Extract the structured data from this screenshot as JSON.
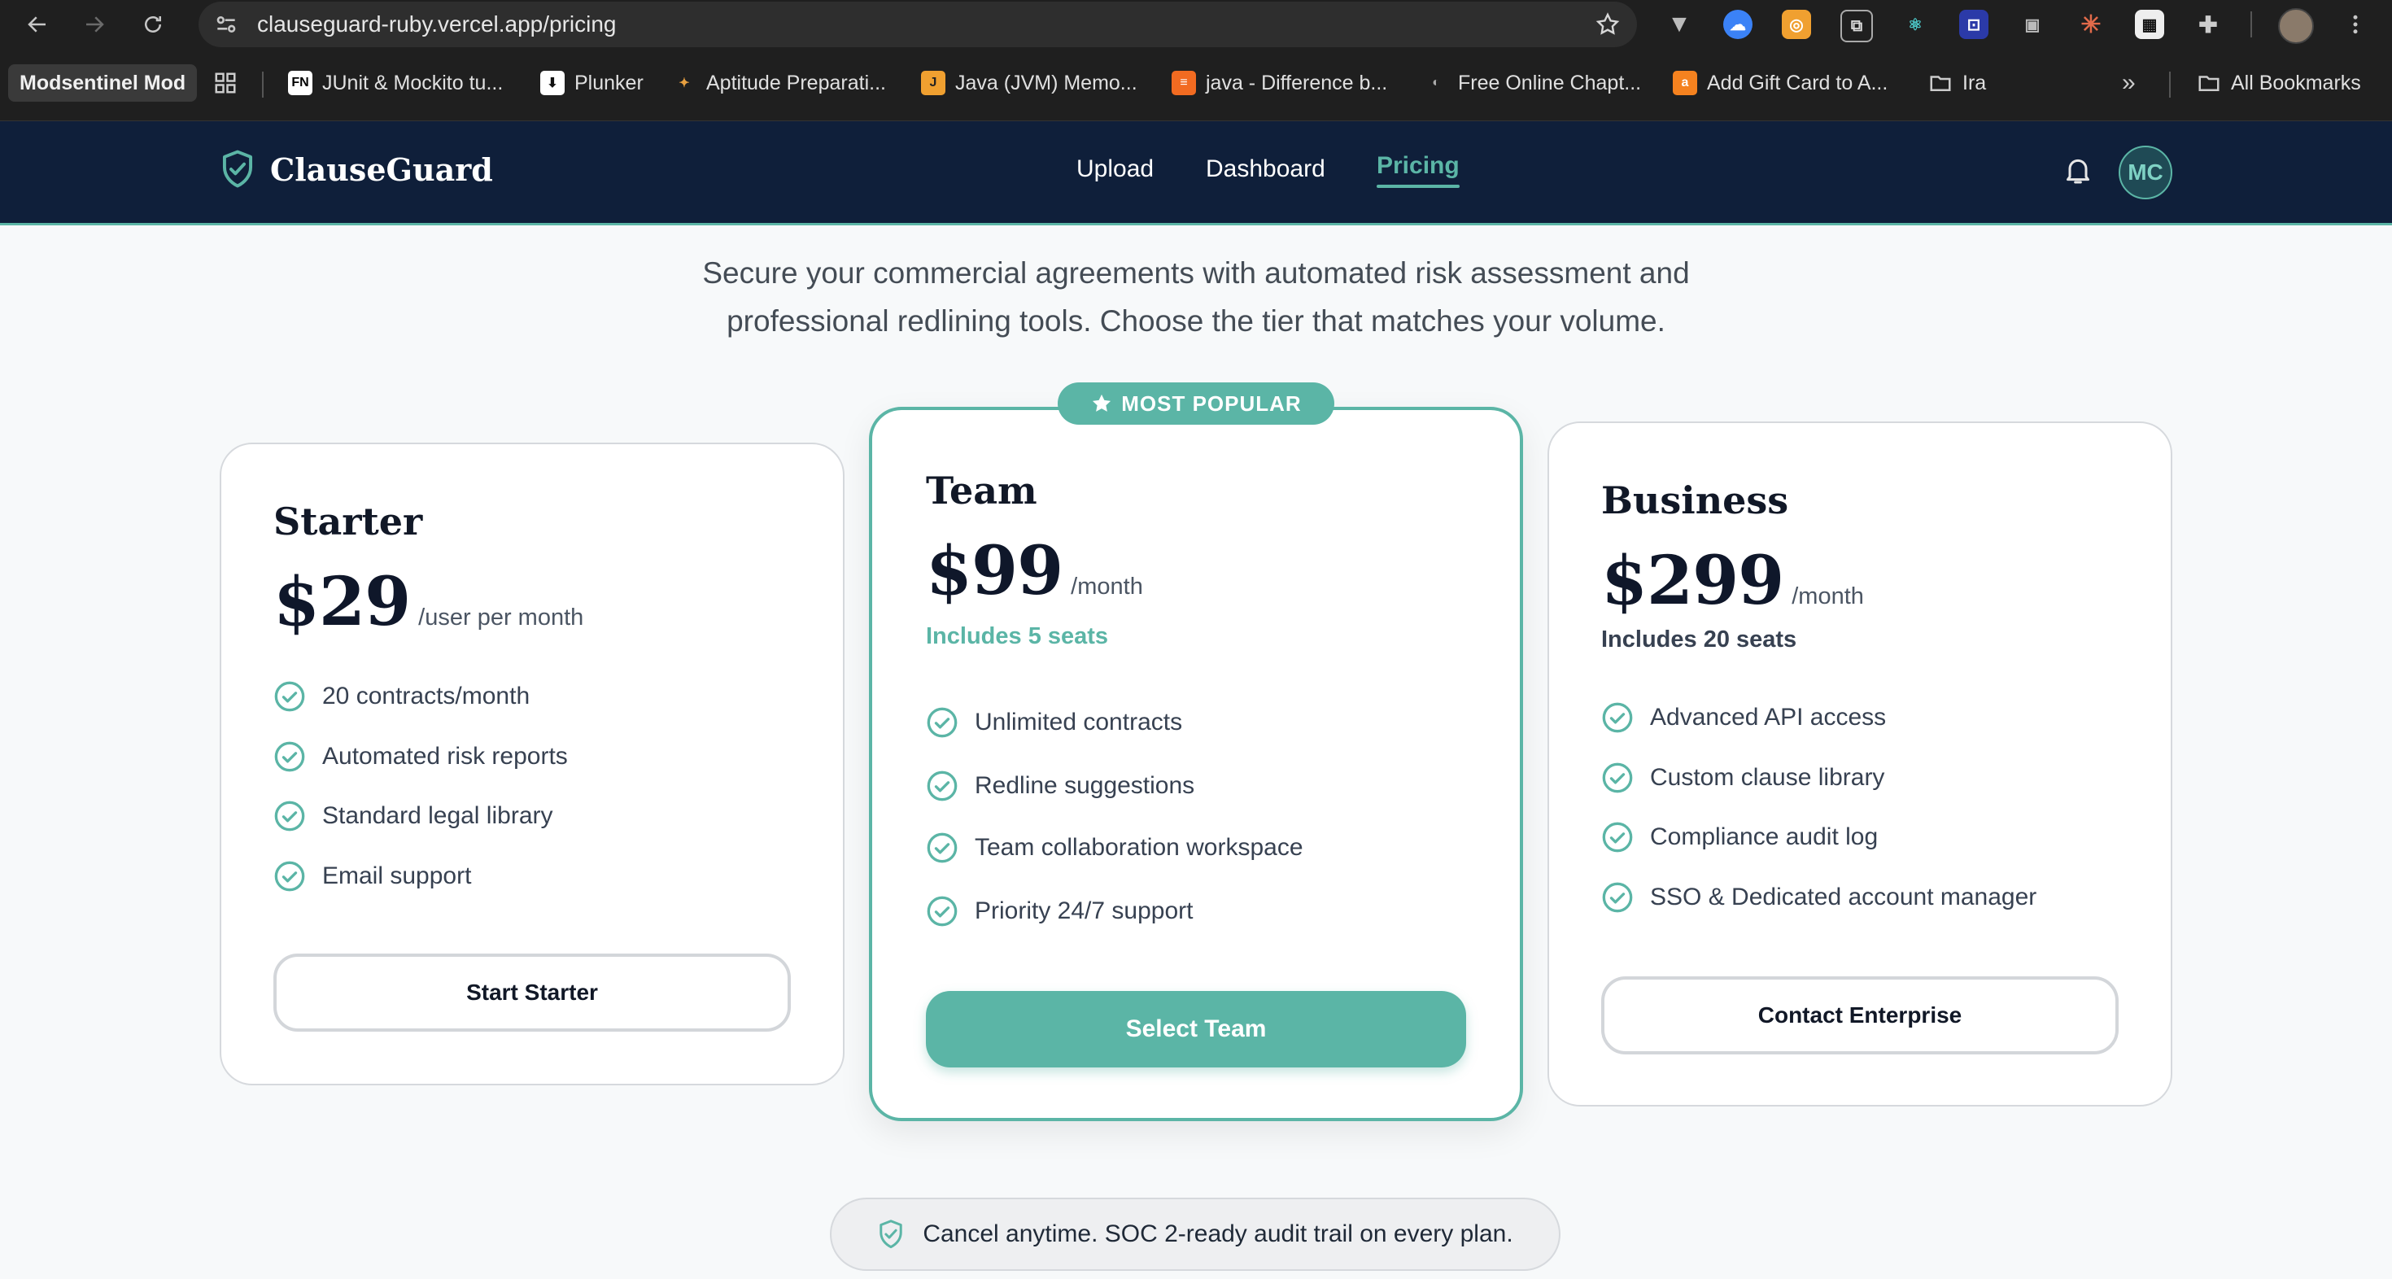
{
  "browser": {
    "url": "clauseguard-ruby.vercel.app/pricing",
    "bookmarks": [
      {
        "label": "Modsentinel Mod",
        "icon": "none"
      },
      {
        "label": "",
        "icon": "apps-grid-icon"
      },
      {
        "label": "JUnit & Mockito tu...",
        "icon": "fn-favicon",
        "fav_text": "FN",
        "fav_color": "#ffffff"
      },
      {
        "label": "Plunker",
        "icon": "plunker-favicon"
      },
      {
        "label": "Aptitude Preparati...",
        "icon": "aptitude-favicon"
      },
      {
        "label": "Java (JVM) Memo...",
        "icon": "java-favicon",
        "fav_text": "J",
        "fav_color": "#f0a030"
      },
      {
        "label": "java - Difference b...",
        "icon": "stackoverflow-favicon"
      },
      {
        "label": "Free Online Chapt...",
        "icon": "chapter-favicon"
      },
      {
        "label": "Add Gift Card to A...",
        "icon": "amazon-favicon",
        "fav_text": "a",
        "fav_color": "#f5821f"
      },
      {
        "label": "Ira",
        "icon": "folder-icon"
      }
    ],
    "all_bookmarks": "All Bookmarks"
  },
  "app": {
    "brand": "ClauseGuard",
    "nav": {
      "upload": "Upload",
      "dashboard": "Dashboard",
      "pricing": "Pricing"
    },
    "avatar_initials": "MC",
    "accent_color": "#5bb5a6",
    "header_color": "#0f1f3a"
  },
  "pricing": {
    "subtitle_line1": "Secure your commercial agreements with automated risk assessment and",
    "subtitle_line2": "professional redlining tools. Choose the tier that matches your volume.",
    "badge": "MOST POPULAR",
    "plans": [
      {
        "name": "Starter",
        "price": "$29",
        "period": "/user per month",
        "seats": "",
        "features": [
          "20 contracts/month",
          "Automated risk reports",
          "Standard legal library",
          "Email support"
        ],
        "cta": "Start Starter"
      },
      {
        "name": "Team",
        "price": "$99",
        "period": "/month",
        "seats": "Includes 5 seats",
        "features": [
          "Unlimited contracts",
          "Redline suggestions",
          "Team collaboration workspace",
          "Priority 24/7 support"
        ],
        "cta": "Select Team"
      },
      {
        "name": "Business",
        "price": "$299",
        "period": "/month",
        "seats": "Includes 20 seats",
        "features": [
          "Advanced API access",
          "Custom clause library",
          "Compliance audit log",
          "SSO & Dedicated account manager"
        ],
        "cta": "Contact Enterprise"
      }
    ],
    "trust_note": "Cancel anytime. SOC 2-ready audit trail on every plan."
  }
}
